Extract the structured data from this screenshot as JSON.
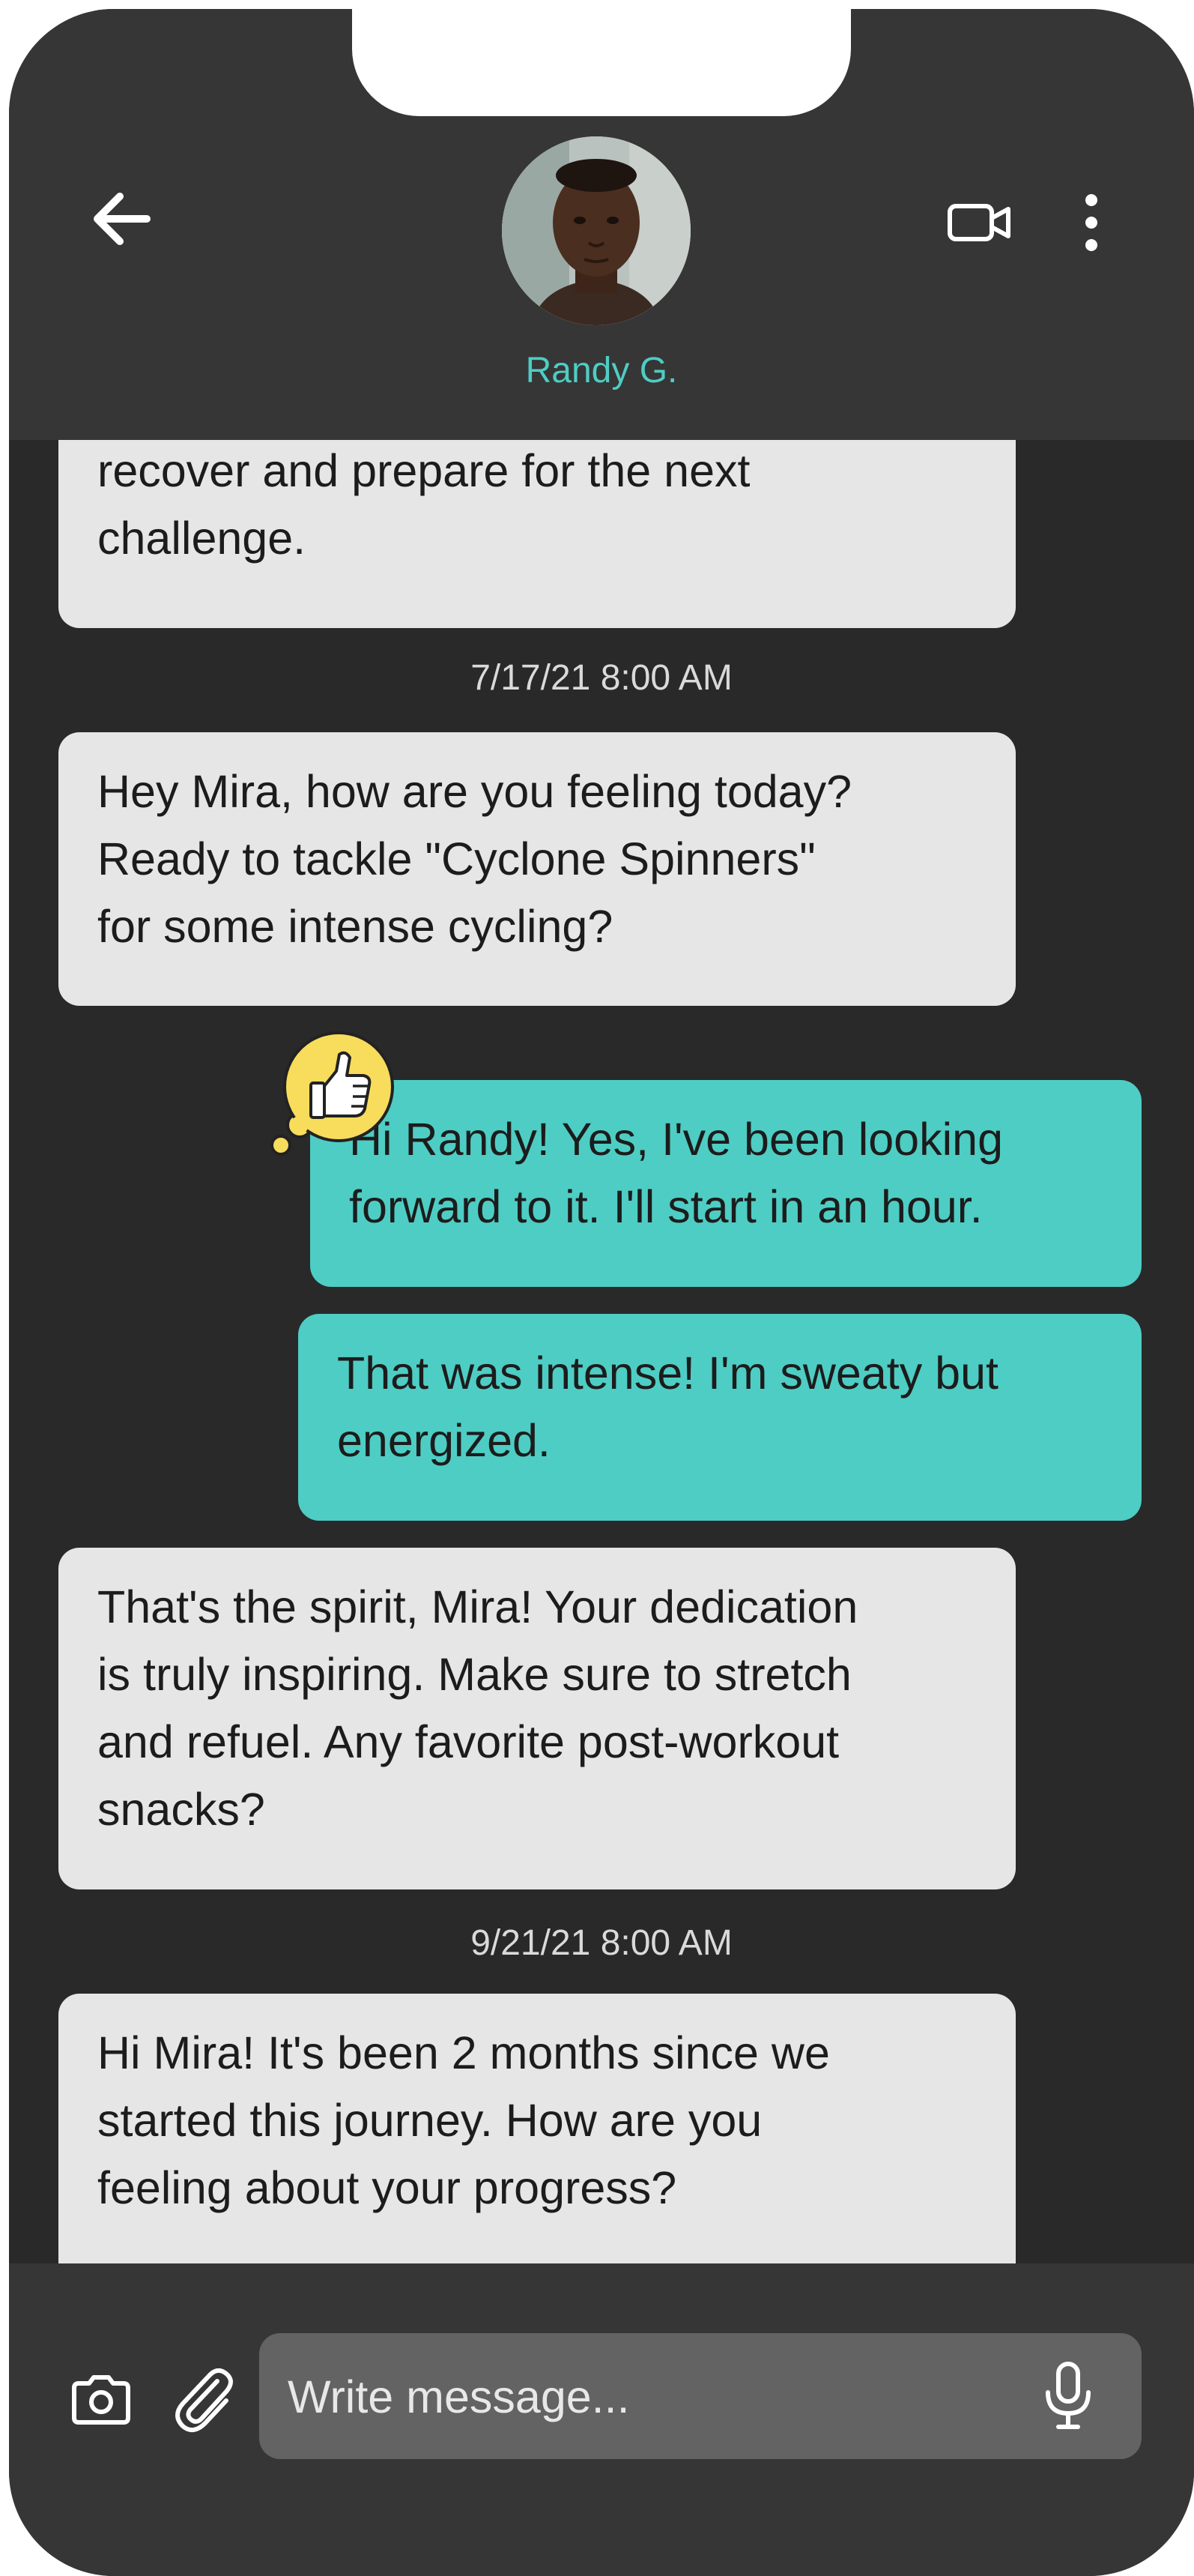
{
  "header": {
    "contact_name": "Randy G.",
    "back_icon": "arrow-left-icon",
    "video_icon": "video-camera-icon",
    "more_icon": "more-vertical-icon",
    "accent": "#4ecdc4"
  },
  "messages": [
    {
      "type": "incoming",
      "text": "recover and prepare for the next\nchallenge."
    },
    {
      "type": "timestamp",
      "text": "7/17/21 8:00 AM"
    },
    {
      "type": "incoming",
      "text": "Hey Mira, how are you feeling today?\nReady to tackle \"Cyclone Spinners\"\nfor some intense cycling?"
    },
    {
      "type": "outgoing",
      "text": "Hi Randy! Yes, I've been looking\nforward to it. I'll start in an hour.",
      "reaction": "thumbs-up-icon"
    },
    {
      "type": "outgoing",
      "text": "That was intense! I'm sweaty but\nenergized."
    },
    {
      "type": "incoming",
      "text": "That's the spirit, Mira! Your dedication\nis truly inspiring. Make sure to stretch\nand refuel. Any favorite post-workout\nsnacks?"
    },
    {
      "type": "timestamp",
      "text": "9/21/21 8:00 AM"
    },
    {
      "type": "incoming",
      "text": "Hi Mira! It's been 2 months since we\nstarted this journey. How are you\nfeeling about your progress?"
    }
  ],
  "composer": {
    "placeholder": "Write message...",
    "camera_icon": "camera-icon",
    "attach_icon": "paperclip-icon",
    "mic_icon": "microphone-icon"
  },
  "colors": {
    "incoming_bubble": "#e6e6e6",
    "outgoing_bubble": "#4ecdc4",
    "background": "#292929",
    "header": "#363636",
    "reaction": "#f8dc5c"
  }
}
